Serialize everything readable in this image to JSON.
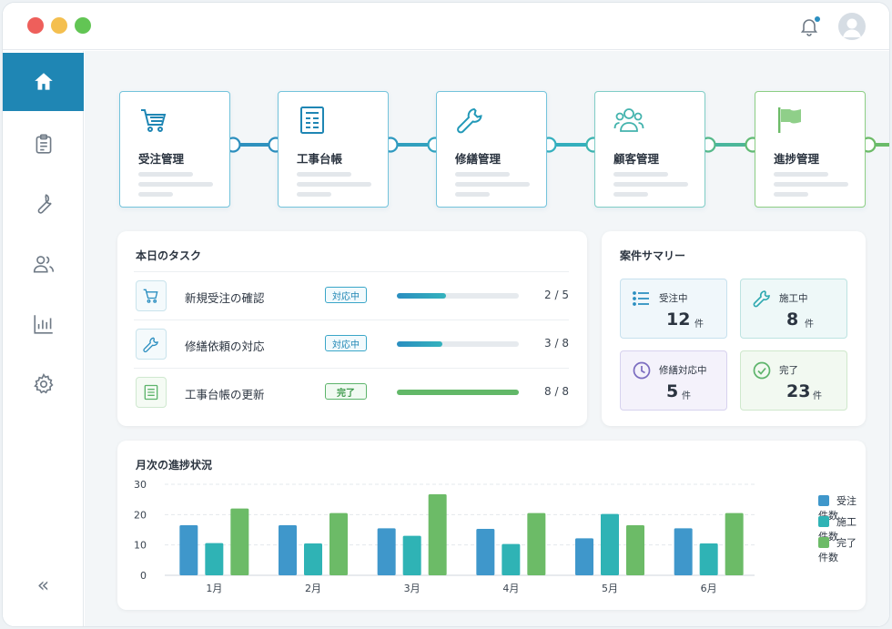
{
  "window": {
    "notification_badge": true
  },
  "sidebar": {
    "items": [
      {
        "icon": "home-icon",
        "active": true
      },
      {
        "icon": "clipboard-icon",
        "active": false
      },
      {
        "icon": "wrench-icon",
        "active": false
      },
      {
        "icon": "users-icon",
        "active": false
      },
      {
        "icon": "bar-chart-icon",
        "active": false
      },
      {
        "icon": "gear-icon",
        "active": false
      }
    ],
    "collapse_label": "«"
  },
  "flow": {
    "steps": [
      {
        "label": "受注管理",
        "icon": "cart-icon"
      },
      {
        "label": "工事台帳",
        "icon": "ledger-icon"
      },
      {
        "label": "修繕管理",
        "icon": "wrench-icon"
      },
      {
        "label": "顧客管理",
        "icon": "customers-icon"
      },
      {
        "label": "進捗管理",
        "icon": "flag-icon"
      }
    ]
  },
  "tasks": {
    "title": "本日のタスク",
    "rows": [
      {
        "name": "新規受注の確認",
        "status": "対応中",
        "done": 2,
        "total": 5,
        "count": "2 / 5"
      },
      {
        "name": "修繕依頼の対応",
        "status": "対応中",
        "done": 3,
        "total": 8,
        "count": "3 / 8"
      },
      {
        "name": "工事台帳の更新",
        "status": "完了",
        "done": 8,
        "total": 8,
        "count": "8 / 8"
      }
    ]
  },
  "summary": {
    "title": "案件サマリー",
    "cards": [
      {
        "label": "受注中",
        "value": "12",
        "unit": "件",
        "icon": "list-icon"
      },
      {
        "label": "施工中",
        "value": "8",
        "unit": "件",
        "icon": "wrench-icon"
      },
      {
        "label": "修繕対応中",
        "value": "5",
        "unit": "件",
        "icon": "clock-icon"
      },
      {
        "label": "完了",
        "value": "23",
        "unit": "件",
        "icon": "check-circle-icon"
      }
    ]
  },
  "chart_section": {
    "title": "月次の進捗状況"
  },
  "chart_data": {
    "type": "bar",
    "title": "月次の進捗状況",
    "categories": [
      "1月",
      "2月",
      "3月",
      "4月",
      "5月",
      "6月"
    ],
    "series": [
      {
        "name": "受注件数",
        "values": [
          16.5,
          16.5,
          15.5,
          15.3,
          12.2,
          15.5
        ],
        "color": "#3f97cb"
      },
      {
        "name": "施工件数",
        "values": [
          10.6,
          10.5,
          13,
          10.3,
          20.2,
          10.5
        ],
        "color": "#2fb3b5"
      },
      {
        "name": "完了件数",
        "values": [
          22,
          20.5,
          26.7,
          20.5,
          16.5,
          20.5
        ],
        "color": "#6cbb67"
      }
    ],
    "ylim": [
      0,
      30
    ],
    "yticks": [
      0,
      10,
      20,
      30
    ],
    "grid": true,
    "legend_position": "right"
  },
  "colors": {
    "accent": "#1f86b4",
    "teal": "#2fb3b5",
    "green": "#6cbb67"
  }
}
